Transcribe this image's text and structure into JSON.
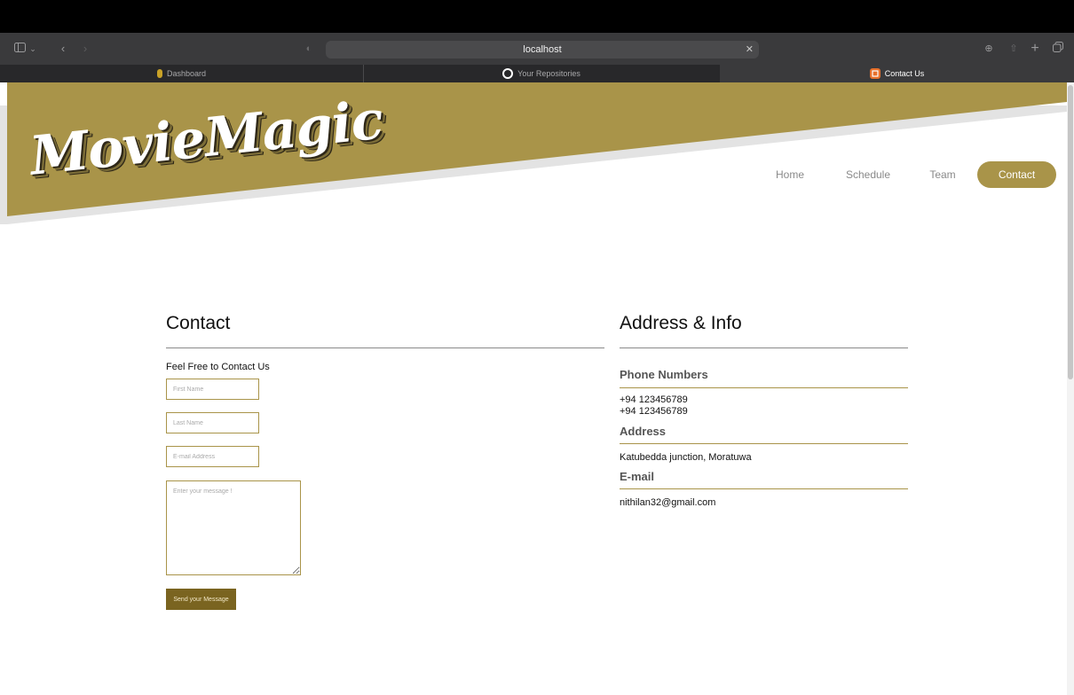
{
  "browser": {
    "url": "localhost",
    "tabs": [
      {
        "label": "Dashboard"
      },
      {
        "label": "Your Repositories"
      },
      {
        "label": "Contact Us"
      }
    ]
  },
  "site": {
    "logo": "MovieMagic",
    "nav": [
      "Home",
      "Schedule",
      "Team",
      "Contact"
    ]
  },
  "contact": {
    "title": "Contact",
    "subtitle": "Feel Free to Contact Us",
    "first_name_placeholder": "First Name",
    "last_name_placeholder": "Last Name",
    "email_placeholder": "E-mail Address",
    "message_placeholder": "Enter your message !",
    "send_label": "Send your Message"
  },
  "info": {
    "title": "Address & Info",
    "phone_heading": "Phone Numbers",
    "phones": [
      "+94 123456789",
      "+94 123456789"
    ],
    "address_heading": "Address",
    "address": "Katubedda junction, Moratuwa",
    "email_heading": "E-mail",
    "email": "nithilan32@gmail.com"
  },
  "colors": {
    "brand_gold": "#a99449",
    "button_dark_gold": "#7a6420"
  }
}
